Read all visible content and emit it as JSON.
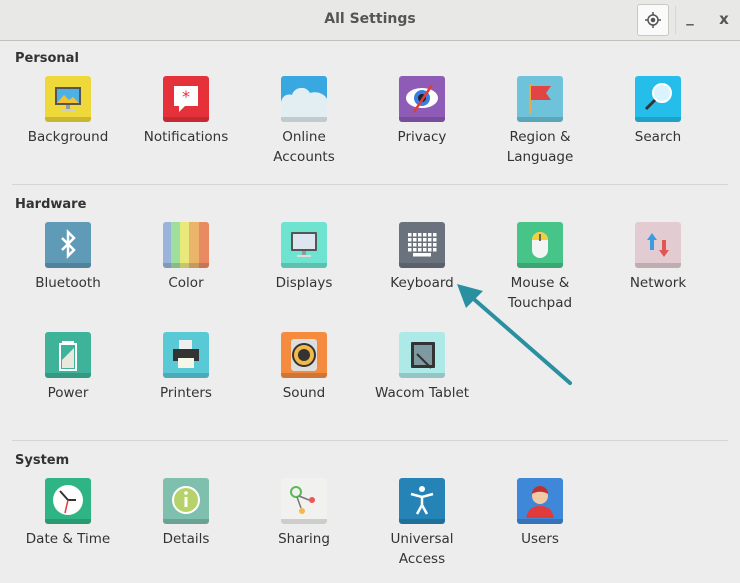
{
  "window": {
    "title": "All Settings",
    "minimize": "_",
    "close": "x"
  },
  "sections": [
    {
      "title": "Personal",
      "items": [
        {
          "label": "Background",
          "icon": "background-icon",
          "color": "#eed83a"
        },
        {
          "label": "Notifications",
          "icon": "notifications-icon",
          "color": "#e5323a"
        },
        {
          "label": "Online\nAccounts",
          "icon": "online-accounts-icon",
          "color": "#39a7e0"
        },
        {
          "label": "Privacy",
          "icon": "privacy-icon",
          "color": "#8e5cb6"
        },
        {
          "label": "Region &\nLanguage",
          "icon": "region-language-icon",
          "color": "#6ec2da"
        },
        {
          "label": "Search",
          "icon": "search-icon",
          "color": "#25bde9"
        }
      ]
    },
    {
      "title": "Hardware",
      "items": [
        {
          "label": "Bluetooth",
          "icon": "bluetooth-icon",
          "color": "#5f9ab7"
        },
        {
          "label": "Color",
          "icon": "color-icon",
          "color": "#9ab3da"
        },
        {
          "label": "Displays",
          "icon": "displays-icon",
          "color": "#6ee3cf"
        },
        {
          "label": "Keyboard",
          "icon": "keyboard-icon",
          "color": "#6a737d"
        },
        {
          "label": "Mouse &\nTouchpad",
          "icon": "mouse-icon",
          "color": "#47c488"
        },
        {
          "label": "Network",
          "icon": "network-icon",
          "color": "#e2ccd2"
        },
        {
          "label": "Power",
          "icon": "power-icon",
          "color": "#3fb39a"
        },
        {
          "label": "Printers",
          "icon": "printers-icon",
          "color": "#5ac9d6"
        },
        {
          "label": "Sound",
          "icon": "sound-icon",
          "color": "#f58b3e"
        },
        {
          "label": "Wacom Tablet",
          "icon": "wacom-tablet-icon",
          "color": "#ade9e6"
        }
      ]
    },
    {
      "title": "System",
      "items": [
        {
          "label": "Date & Time",
          "icon": "date-time-icon",
          "color": "#2fb486"
        },
        {
          "label": "Details",
          "icon": "details-icon",
          "color": "#7fbfae"
        },
        {
          "label": "Sharing",
          "icon": "sharing-icon",
          "color": "#f1f1ef"
        },
        {
          "label": "Universal\nAccess",
          "icon": "universal-access-icon",
          "color": "#2683b5"
        },
        {
          "label": "Users",
          "icon": "users-icon",
          "color": "#3f87d8"
        }
      ]
    }
  ],
  "annotation": {
    "arrow_color": "#2a8fa0",
    "points_to": "Keyboard"
  }
}
